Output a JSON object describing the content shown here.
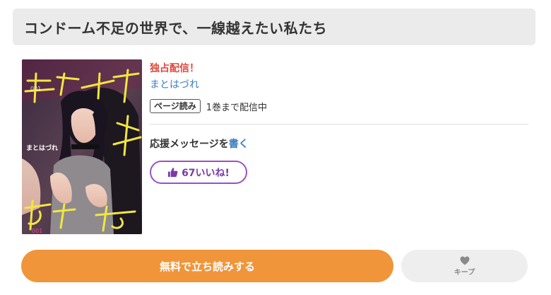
{
  "header": {
    "title": "コンドーム不足の世界で、一線越えたい私たち"
  },
  "book": {
    "cover_title_lines": [
      "コンドーム",
      "不足の世界で",
      "一線",
      "越えたい",
      "私たち"
    ],
    "cover_author": "まとはづれ",
    "exclusive_label": "独占配信！",
    "author": "まとはづれ",
    "format_badge": "ページ読み",
    "volume_status": "1巻まで配信中"
  },
  "support": {
    "prefix": "応援メッセージを",
    "link_label": "書く"
  },
  "like": {
    "count_label": "67いいね!"
  },
  "actions": {
    "read_label": "無料で立ち読みする",
    "keep_label": "キープ"
  },
  "colors": {
    "accent_orange": "#f0953a",
    "exclusive_red": "#e0463a",
    "link_blue": "#3d7dc0",
    "like_purple": "#9b4fc5",
    "cover_title_yellow": "#f2e640"
  },
  "icons": {
    "like": "thumbs-up-icon",
    "keep": "heart-icon"
  }
}
